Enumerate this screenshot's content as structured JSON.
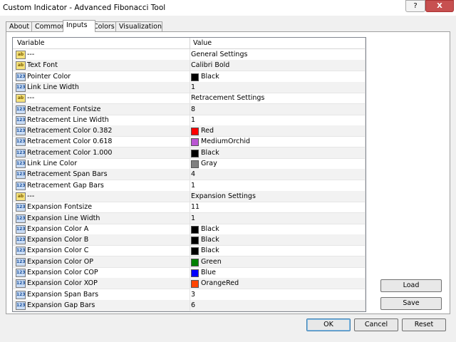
{
  "window": {
    "title": "Custom Indicator - Advanced Fibonacci Tool",
    "help_label": "?",
    "close_label": "X"
  },
  "tabs": [
    {
      "label": "About"
    },
    {
      "label": "Common"
    },
    {
      "label": "Inputs"
    },
    {
      "label": "Colors"
    },
    {
      "label": "Visualization"
    }
  ],
  "grid": {
    "headers": {
      "variable": "Variable",
      "value": "Value"
    },
    "rows": [
      {
        "icon": "ab",
        "variable": "---",
        "value": "General Settings"
      },
      {
        "icon": "ab",
        "variable": "Text Font",
        "value": "Calibri Bold"
      },
      {
        "icon": "num",
        "variable": "Pointer Color",
        "value": "Black",
        "color": "#000000"
      },
      {
        "icon": "num",
        "variable": "Link Line Width",
        "value": "1"
      },
      {
        "icon": "ab",
        "variable": "---",
        "value": "Retracement Settings"
      },
      {
        "icon": "num",
        "variable": "Retracement Fontsize",
        "value": "8"
      },
      {
        "icon": "num",
        "variable": "Retracement Line Width",
        "value": "1"
      },
      {
        "icon": "num",
        "variable": "Retracement Color 0.382",
        "value": "Red",
        "color": "#ff0000"
      },
      {
        "icon": "num",
        "variable": "Retracement Color 0.618",
        "value": "MediumOrchid",
        "color": "#ba55d3"
      },
      {
        "icon": "num",
        "variable": "Retracement Color 1.000",
        "value": "Black",
        "color": "#000000"
      },
      {
        "icon": "num",
        "variable": "Link Line Color",
        "value": "Gray",
        "color": "#808080"
      },
      {
        "icon": "num",
        "variable": "Retracement Span Bars",
        "value": "4"
      },
      {
        "icon": "num",
        "variable": "Retracement Gap Bars",
        "value": "1"
      },
      {
        "icon": "ab",
        "variable": "---",
        "value": "Expansion Settings"
      },
      {
        "icon": "num",
        "variable": "Expansion Fontsize",
        "value": "11"
      },
      {
        "icon": "num",
        "variable": "Expansion Line Width",
        "value": "1"
      },
      {
        "icon": "num",
        "variable": "Expansion Color A",
        "value": "Black",
        "color": "#000000"
      },
      {
        "icon": "num",
        "variable": "Expansion Color B",
        "value": "Black",
        "color": "#000000"
      },
      {
        "icon": "num",
        "variable": "Expansion Color C",
        "value": "Black",
        "color": "#000000"
      },
      {
        "icon": "num",
        "variable": "Expansion Color OP",
        "value": "Green",
        "color": "#008000"
      },
      {
        "icon": "num",
        "variable": "Expansion Color COP",
        "value": "Blue",
        "color": "#0000ff"
      },
      {
        "icon": "num",
        "variable": "Expansion Color XOP",
        "value": "OrangeRed",
        "color": "#ff4500"
      },
      {
        "icon": "num",
        "variable": "Expansion Span Bars",
        "value": "3"
      },
      {
        "icon": "num",
        "variable": "Expansion Gap Bars",
        "value": "6"
      }
    ]
  },
  "icons": {
    "ab": "ab",
    "num": "123"
  },
  "side_buttons": {
    "load": "Load",
    "save": "Save"
  },
  "footer_buttons": {
    "ok": "OK",
    "cancel": "Cancel",
    "reset": "Reset"
  }
}
